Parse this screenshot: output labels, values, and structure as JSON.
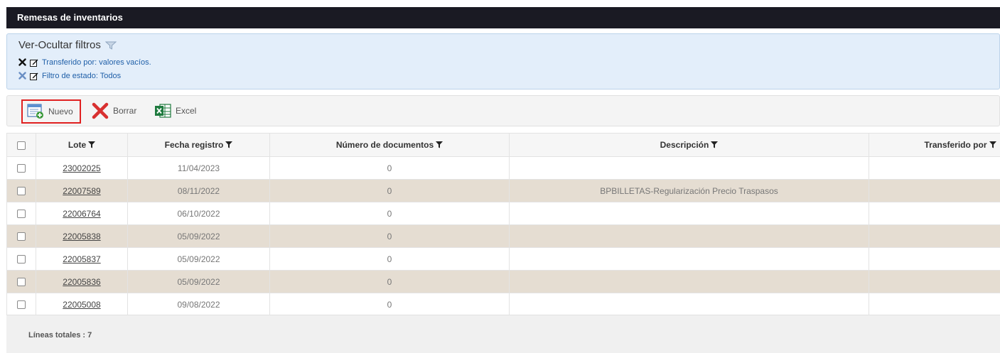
{
  "window": {
    "title": "Remesas de inventarios"
  },
  "filters": {
    "toggle_label": "Ver-Ocultar filtros",
    "active": [
      {
        "text": "Transferido por: valores vacíos.",
        "remove_color": "#111111"
      },
      {
        "text": "Filtro de estado: Todos",
        "remove_color": "#6a8fc4"
      }
    ]
  },
  "toolbar": {
    "new_label": "Nuevo",
    "delete_label": "Borrar",
    "excel_label": "Excel"
  },
  "table": {
    "columns": [
      "Lote",
      "Fecha registro",
      "Número de documentos",
      "Descripción",
      "Transferido por"
    ],
    "rows": [
      {
        "lote": "23002025",
        "fecha": "11/04/2023",
        "num_docs": "0",
        "descripcion": "",
        "transferido": ""
      },
      {
        "lote": "22007589",
        "fecha": "08/11/2022",
        "num_docs": "0",
        "descripcion": "BPBILLETAS-Regularización Precio Traspasos",
        "transferido": ""
      },
      {
        "lote": "22006764",
        "fecha": "06/10/2022",
        "num_docs": "0",
        "descripcion": "",
        "transferido": ""
      },
      {
        "lote": "22005838",
        "fecha": "05/09/2022",
        "num_docs": "0",
        "descripcion": "",
        "transferido": ""
      },
      {
        "lote": "22005837",
        "fecha": "05/09/2022",
        "num_docs": "0",
        "descripcion": "",
        "transferido": ""
      },
      {
        "lote": "22005836",
        "fecha": "05/09/2022",
        "num_docs": "0",
        "descripcion": "",
        "transferido": ""
      },
      {
        "lote": "22005008",
        "fecha": "09/08/2022",
        "num_docs": "0",
        "descripcion": "",
        "transferido": ""
      }
    ]
  },
  "footer": {
    "total_label": "Líneas totales : 7"
  },
  "colors": {
    "title_bar": "#1a1a23",
    "filter_panel": "#e3eefa",
    "alt_row": "#e5ddd2",
    "highlight_border": "#e02020",
    "link": "#1f5fa8"
  }
}
